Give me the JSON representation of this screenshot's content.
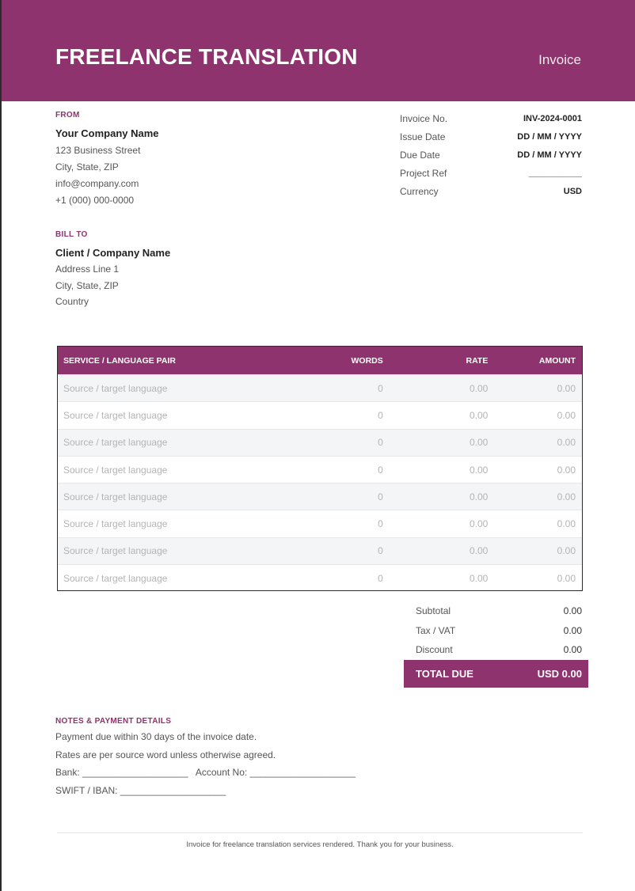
{
  "header": {
    "title": "FREELANCE TRANSLATION",
    "doc_type": "Invoice"
  },
  "from": {
    "label": "FROM",
    "name": "Your Company Name",
    "street": "123 Business Street",
    "city": "City, State, ZIP",
    "email": "info@company.com",
    "phone": "+1 (000) 000-0000"
  },
  "bill_to": {
    "label": "BILL TO",
    "name": "Client / Company Name",
    "address": "Address Line 1",
    "city": "City, State, ZIP",
    "country": "Country"
  },
  "meta": [
    {
      "key": "Invoice No.",
      "value": "INV-2024-0001"
    },
    {
      "key": "Issue Date",
      "value": "DD / MM / YYYY"
    },
    {
      "key": "Due Date",
      "value": "DD / MM / YYYY"
    },
    {
      "key": "Project Ref",
      "value": "___________"
    },
    {
      "key": "Currency",
      "value": "USD"
    }
  ],
  "table": {
    "columns": [
      "SERVICE / LANGUAGE PAIR",
      "WORDS",
      "RATE",
      "AMOUNT"
    ],
    "rows": [
      {
        "service": "Source / target language",
        "words": "0",
        "rate": "0.00",
        "amount": "0.00"
      },
      {
        "service": "Source / target language",
        "words": "0",
        "rate": "0.00",
        "amount": "0.00"
      },
      {
        "service": "Source / target language",
        "words": "0",
        "rate": "0.00",
        "amount": "0.00"
      },
      {
        "service": "Source / target language",
        "words": "0",
        "rate": "0.00",
        "amount": "0.00"
      },
      {
        "service": "Source / target language",
        "words": "0",
        "rate": "0.00",
        "amount": "0.00"
      },
      {
        "service": "Source / target language",
        "words": "0",
        "rate": "0.00",
        "amount": "0.00"
      },
      {
        "service": "Source / target language",
        "words": "0",
        "rate": "0.00",
        "amount": "0.00"
      },
      {
        "service": "Source / target language",
        "words": "0",
        "rate": "0.00",
        "amount": "0.00"
      }
    ]
  },
  "totals": {
    "subtotal_label": "Subtotal",
    "subtotal": "0.00",
    "tax_label": "Tax / VAT",
    "tax": "0.00",
    "discount_label": "Discount",
    "discount": "0.00",
    "due_label": "TOTAL DUE",
    "due": "USD 0.00"
  },
  "notes": {
    "label": "NOTES & PAYMENT DETAILS",
    "line1": "Payment due within 30 days of the invoice date.",
    "line2": "Rates are per source word unless otherwise agreed.",
    "line3": "Bank: ____________________   Account No: ____________________",
    "line4": "SWIFT / IBAN: ____________________"
  },
  "footer": "Invoice for freelance translation services rendered. Thank you for your business.",
  "colors": {
    "brand": "#8e336d",
    "row_alt": "#f4f5f7",
    "placeholder_text": "#b4b4b4"
  }
}
